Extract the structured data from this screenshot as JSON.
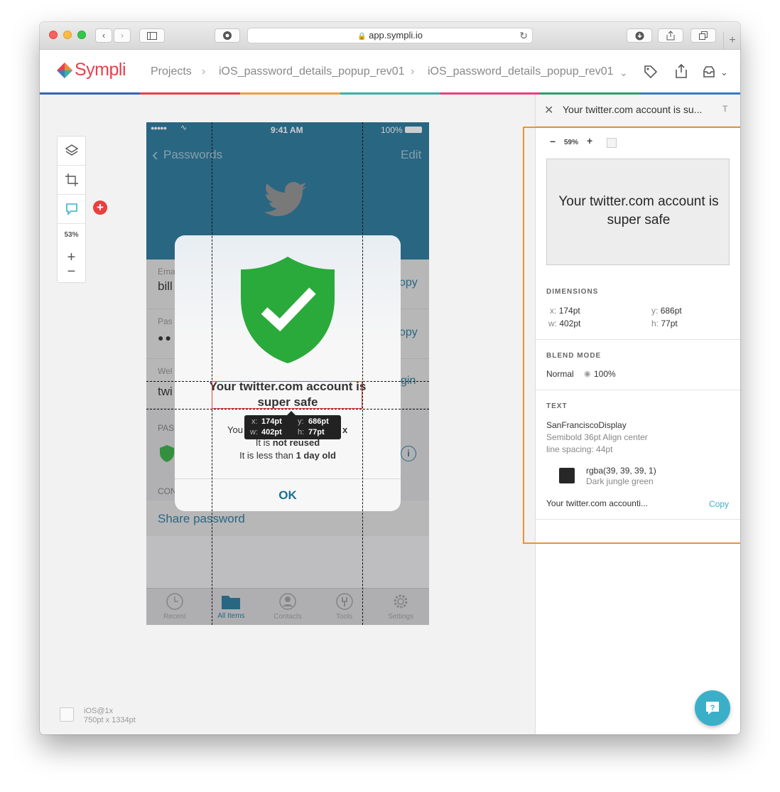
{
  "browser": {
    "url": "app.sympli.io"
  },
  "app": {
    "logo": "Sympli",
    "breadcrumbs": [
      "Projects",
      "iOS_password_details_popup_rev01",
      "iOS_password_details_popup_rev01"
    ]
  },
  "toolbar": {
    "zoom": "53%"
  },
  "device": {
    "name": "iOS@1x",
    "size": "750pt x 1334pt"
  },
  "phone": {
    "status": {
      "dots": "●●●●●",
      "time": "9:41 AM",
      "battery": "100%"
    },
    "nav": {
      "back": "Passwords",
      "edit": "Edit"
    },
    "rows": {
      "email_label": "Ema",
      "email_value": "bill",
      "password_label": "Pas",
      "password_value": "●●",
      "website_label": "Wel",
      "website_value": "twi",
      "copy1": "opy",
      "copy2": "opy",
      "login": "gin",
      "section_label": "PAS",
      "section2_label": "CON",
      "share": "Share password"
    },
    "alert": {
      "title": "Your twitter.com account is super safe",
      "line1_pre": "You",
      "line1_post": "x",
      "line2_pre": "It is ",
      "line2_bold": "not reused",
      "line3_pre": "It is less than ",
      "line3_bold": "1 day old",
      "ok": "OK"
    },
    "tabs": [
      "Recent",
      "All Items",
      "Contacts",
      "Tools",
      "Settings"
    ],
    "measure": {
      "x_label": "x:",
      "x": "174pt",
      "y_label": "y:",
      "y": "686pt",
      "w_label": "w:",
      "w": "402pt",
      "h_label": "h:",
      "h": "77pt"
    }
  },
  "panel": {
    "title": "Your twitter.com account is su...",
    "zoom": "59%",
    "preview_text": "Your twitter.com account is super safe",
    "dimensions_label": "DIMENSIONS",
    "dims": {
      "x_label": "x:",
      "x": "174pt",
      "y_label": "y:",
      "y": "686pt",
      "w_label": "w:",
      "w": "402pt",
      "h_label": "h:",
      "h": "77pt"
    },
    "blend_label": "BLEND MODE",
    "blend_mode": "Normal",
    "opacity": "100%",
    "text_label": "TEXT",
    "font_name": "SanFranciscoDisplay",
    "font_style": "Semibold 36pt Align center",
    "line_spacing": "line spacing: 44pt",
    "color_value": "rgba(39, 39, 39, 1)",
    "color_name": "Dark jungle green",
    "text_content": "Your twitter.com accounti...",
    "copy": "Copy"
  },
  "colors": {
    "accent": "#3ab0c8",
    "highlight": "#f0912e",
    "shield": "#2aaa3a",
    "nav_bg": "#1b6f96",
    "swatch": "#272727"
  }
}
